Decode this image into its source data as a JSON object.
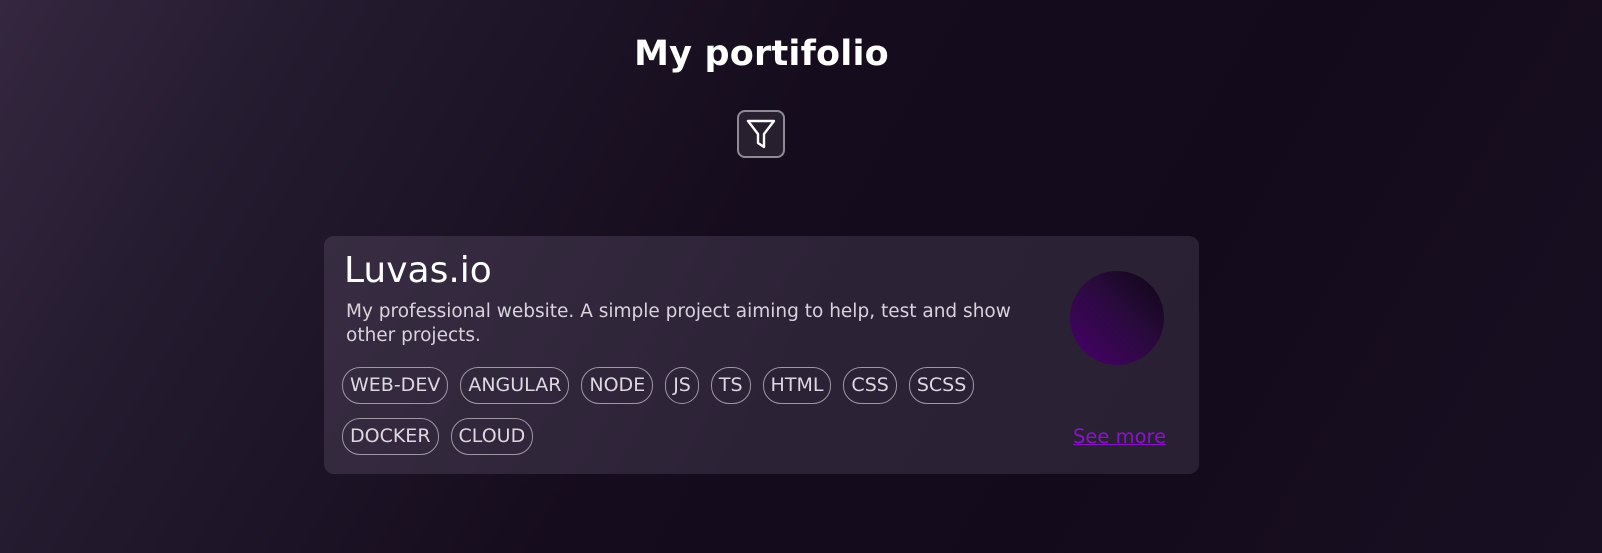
{
  "header": {
    "title": "My portifolio",
    "filter_icon": "filter-icon"
  },
  "projects": [
    {
      "title": "Luvas.io",
      "description": "My professional website. A simple project aiming to help, test and show other projects.",
      "tags": [
        "WEB-DEV",
        "ANGULAR",
        "NODE",
        "JS",
        "TS",
        "HTML",
        "CSS",
        "SCSS",
        "DOCKER",
        "CLOUD"
      ],
      "link_label": "See more"
    }
  ],
  "colors": {
    "link": "#8a13c9",
    "avatar_gradient": [
      "#48006b",
      "#0d0612"
    ]
  }
}
